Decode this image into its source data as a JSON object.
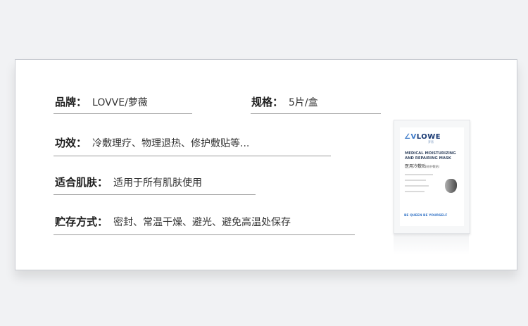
{
  "brand": {
    "label": "品牌：",
    "value": "LOVVE/萝薇"
  },
  "spec": {
    "label": "规格：",
    "value": "5片/盒"
  },
  "effect": {
    "label": "功效：",
    "value": "冷敷理疗、物理退热、修护敷贴等..."
  },
  "skin": {
    "label": "适合肌肤：",
    "value": "适用于所有肌肤使用"
  },
  "storage": {
    "label": "贮存方式：",
    "value": "密封、常温干燥、避光、避免高温处保存"
  },
  "package": {
    "logo": "LOWE",
    "logo_sub": "萝薇",
    "title": "MEDICAL MOISTURIZING AND REPAIRING MASK",
    "cn_name": "医用冷敷贴",
    "cn_tag": "(修护敷贴)",
    "slogan": "BE QUEEN BE YOURSELF"
  },
  "colors": {
    "accent": "#3a78c8",
    "navy": "#1a3a73",
    "text": "#1e1e1e",
    "card_bg": "#ffffff",
    "page_bg": "#f1f2f4"
  }
}
